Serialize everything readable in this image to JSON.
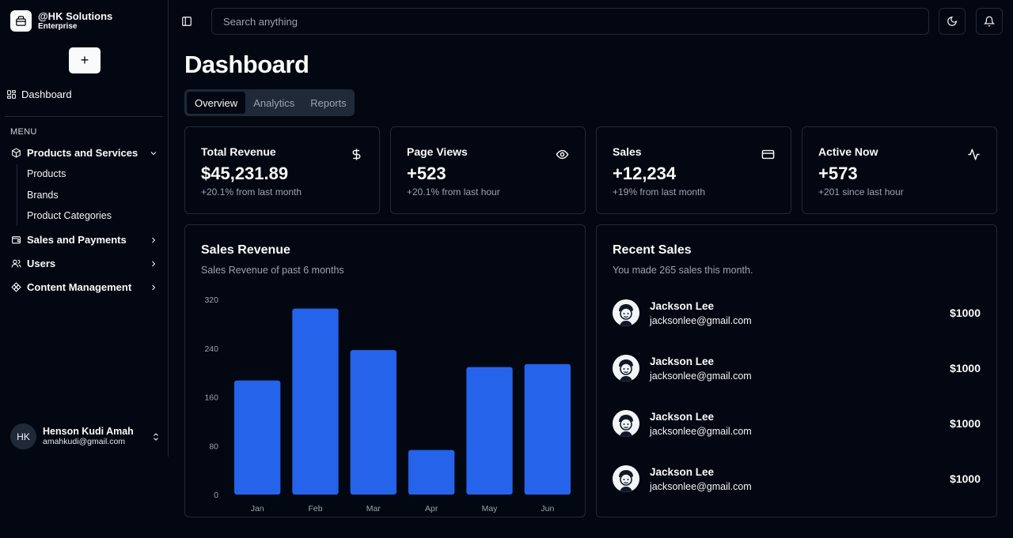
{
  "sidebar": {
    "brand_name": "@HK Solutions",
    "brand_sub": "Enterprise",
    "new_button": "+",
    "dashboard_label": "Dashboard",
    "menu_label": "MENU",
    "groups": [
      {
        "label": "Products and Services",
        "icon": "package-icon",
        "expanded": true,
        "items": [
          "Products",
          "Brands",
          "Product Categories"
        ]
      },
      {
        "label": "Sales and Payments",
        "icon": "wallet-icon",
        "expanded": false
      },
      {
        "label": "Users",
        "icon": "users-icon",
        "expanded": false
      },
      {
        "label": "Content Management",
        "icon": "component-icon",
        "expanded": false
      }
    ],
    "user": {
      "initials": "HK",
      "name": "Henson Kudi Amah",
      "email": "amahkudi@gmail.com"
    }
  },
  "header": {
    "search_placeholder": "Search anything",
    "theme_icon": "moon-icon",
    "notifications_icon": "bell-icon"
  },
  "main": {
    "title": "Dashboard",
    "tabs": [
      {
        "label": "Overview",
        "active": true
      },
      {
        "label": "Analytics",
        "active": false
      },
      {
        "label": "Reports",
        "active": false
      }
    ],
    "stats": [
      {
        "title": "Total Revenue",
        "value": "$45,231.89",
        "sub": "+20.1% from last month",
        "icon": "dollar-icon"
      },
      {
        "title": "Page Views",
        "value": "+523",
        "sub": "+20.1% from last hour",
        "icon": "eye-icon"
      },
      {
        "title": "Sales",
        "value": "+12,234",
        "sub": "+19% from last month",
        "icon": "credit-card-icon"
      },
      {
        "title": "Active Now",
        "value": "+573",
        "sub": "+201 since last hour",
        "icon": "activity-icon"
      }
    ],
    "sales_revenue": {
      "title": "Sales Revenue",
      "description": "Sales Revenue of past 6 months"
    },
    "recent_sales": {
      "title": "Recent Sales",
      "description": "You made 265 sales this month.",
      "rows": [
        {
          "name": "Jackson Lee",
          "email": "jacksonlee@gmail.com",
          "amount": "$1000"
        },
        {
          "name": "Jackson Lee",
          "email": "jacksonlee@gmail.com",
          "amount": "$1000"
        },
        {
          "name": "Jackson Lee",
          "email": "jacksonlee@gmail.com",
          "amount": "$1000"
        },
        {
          "name": "Jackson Lee",
          "email": "jacksonlee@gmail.com",
          "amount": "$1000"
        }
      ]
    }
  },
  "colors": {
    "background": "#030712",
    "border": "#1f2937",
    "bar": "#2563eb",
    "muted": "#9ca3af"
  },
  "chart_data": {
    "type": "bar",
    "categories": [
      "Jan",
      "Feb",
      "Mar",
      "Apr",
      "May",
      "Jun"
    ],
    "values": [
      187,
      305,
      237,
      73,
      209,
      214
    ],
    "yticks": [
      "0",
      "80",
      "160",
      "240",
      "320"
    ],
    "ylim": [
      0,
      320
    ],
    "grid": false,
    "legend": "none"
  }
}
